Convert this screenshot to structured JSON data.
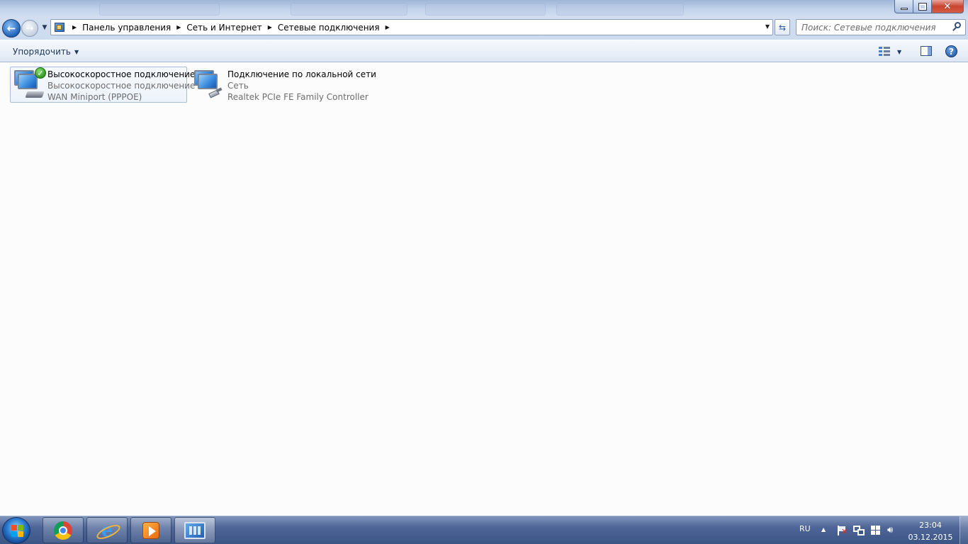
{
  "window": {
    "controls": {
      "minimize_icon": "minimize-icon",
      "maximize_icon": "restore-icon",
      "close_icon": "close-icon"
    }
  },
  "navigation": {
    "back_icon": "back-arrow-icon",
    "forward_icon": "forward-arrow-icon",
    "breadcrumbs": [
      "Панель управления",
      "Сеть и Интернет",
      "Сетевые подключения"
    ],
    "refresh_icon": "refresh-icon"
  },
  "search": {
    "placeholder": "Поиск: Сетевые подключения",
    "value": ""
  },
  "toolbar": {
    "organize_label": "Упорядочить",
    "view_icon": "change-view-icon",
    "preview_pane_icon": "preview-pane-icon",
    "help_icon": "help-icon"
  },
  "connections": [
    {
      "name": "Высокоскоростное подключение",
      "type": "Высокоскоростное подключение",
      "device": "WAN Miniport (PPPOE)",
      "status": "connected",
      "selected": true
    },
    {
      "name": "Подключение по локальной сети",
      "type": "Сеть",
      "device": "Realtek PCIe FE Family Controller",
      "status": "normal",
      "selected": false
    }
  ],
  "taskbar": {
    "start_icon": "windows-start-icon",
    "apps": [
      "chrome-icon",
      "internet-explorer-icon",
      "media-player-icon",
      "control-panel-icon"
    ],
    "language": "RU",
    "time": "23:04",
    "date": "03.12.2015"
  },
  "colors": {
    "accent": "#3b5585",
    "selection_border": "#a7bcd9",
    "check_green": "#2e9a1f"
  }
}
